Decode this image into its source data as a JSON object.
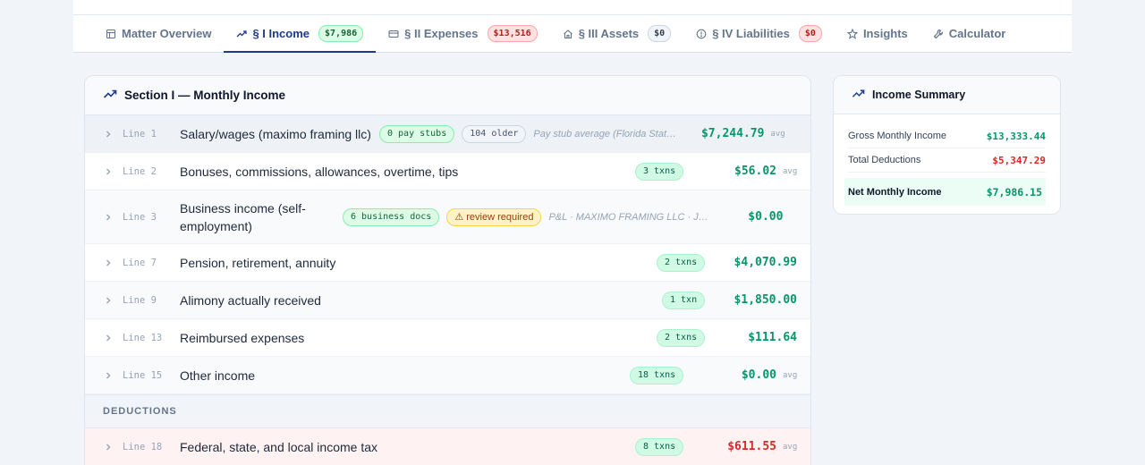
{
  "tabs": [
    {
      "label": "Matter Overview",
      "icon": "document-icon",
      "badge": null
    },
    {
      "label": "§ I Income",
      "icon": "trending-up-icon",
      "badge": "$7,986",
      "badge_color": "green",
      "active": true
    },
    {
      "label": "§ II Expenses",
      "icon": "credit-card-icon",
      "badge": "$13,516",
      "badge_color": "red"
    },
    {
      "label": "§ III Assets",
      "icon": "home-icon",
      "badge": "$0",
      "badge_color": "gray"
    },
    {
      "label": "§ IV Liabilities",
      "icon": "alert-circle-icon",
      "badge": "$0",
      "badge_color": "red"
    },
    {
      "label": "Insights",
      "icon": "star-icon",
      "badge": null
    },
    {
      "label": "Calculator",
      "icon": "wrench-icon",
      "badge": null
    }
  ],
  "income_section": {
    "title": "Section I — Monthly Income",
    "rows": [
      {
        "line": "Line 1",
        "description": "Salary/wages (maximo framing llc)",
        "chips": [
          {
            "text": "0 pay stubs",
            "style": "green"
          },
          {
            "text": "104 older",
            "style": "gray"
          }
        ],
        "note": "Pay stub average (Florida Stat…",
        "amount": "$7,244.79",
        "avg": "avg"
      },
      {
        "line": "Line 2",
        "description": "Bonuses, commissions, allowances, overtime, tips",
        "chips": [
          {
            "text": "3 txns",
            "style": "mint"
          }
        ],
        "note": "",
        "amount": "$56.02",
        "avg": "avg"
      },
      {
        "line": "Line 3",
        "description": "Business income (self-employment)",
        "chips": [
          {
            "text": "6 business docs",
            "style": "green"
          },
          {
            "text": "⚠ review required",
            "style": "warn"
          }
        ],
        "note": "P&L · MAXIMO FRAMING LLC · Jan…",
        "amount": "$0.00",
        "avg": ""
      },
      {
        "line": "Line 7",
        "description": "Pension, retirement, annuity",
        "chips": [
          {
            "text": "2 txns",
            "style": "mint"
          }
        ],
        "note": "",
        "amount": "$4,070.99",
        "avg": ""
      },
      {
        "line": "Line 9",
        "description": "Alimony actually received",
        "chips": [
          {
            "text": "1 txn",
            "style": "mint"
          }
        ],
        "note": "",
        "amount": "$1,850.00",
        "avg": ""
      },
      {
        "line": "Line 13",
        "description": "Reimbursed expenses",
        "chips": [
          {
            "text": "2 txns",
            "style": "mint"
          }
        ],
        "note": "",
        "amount": "$111.64",
        "avg": ""
      },
      {
        "line": "Line 15",
        "description": "Other income",
        "chips": [
          {
            "text": "18 txns",
            "style": "mint"
          }
        ],
        "note": "",
        "amount": "$0.00",
        "avg": "avg"
      }
    ],
    "deductions_label": "DEDUCTIONS",
    "deductions": [
      {
        "line": "Line 18",
        "description": "Federal, state, and local income tax",
        "chips": [
          {
            "text": "8 txns",
            "style": "mint"
          }
        ],
        "note": "",
        "amount": "$611.55",
        "avg": "avg"
      }
    ]
  },
  "summary": {
    "title": "Income Summary",
    "gross_label": "Gross Monthly Income",
    "gross_value": "$13,333.44",
    "deductions_label": "Total Deductions",
    "deductions_value": "$5,347.29",
    "net_label": "Net Monthly Income",
    "net_value": "$7,986.15"
  },
  "colors": {
    "accent": "#1e3a8a",
    "positive": "#059669",
    "negative": "#dc2626"
  }
}
